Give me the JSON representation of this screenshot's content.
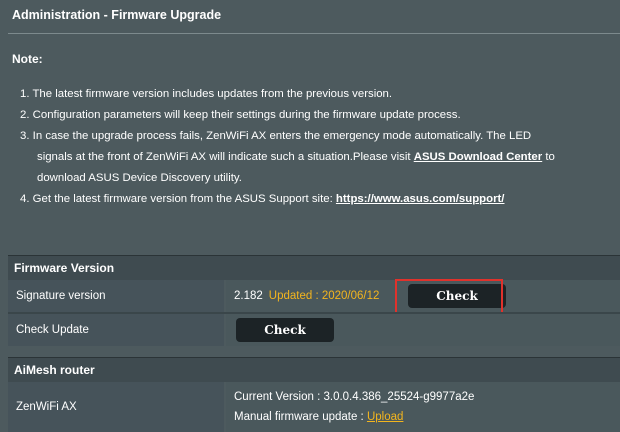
{
  "header": {
    "title": "Administration - Firmware Upgrade"
  },
  "note": {
    "label": "Note:",
    "items": [
      "1. The latest firmware version includes updates from the previous version.",
      "2. Configuration parameters will keep their settings during the firmware update process.",
      "3. In case the upgrade process fails, ZenWiFi AX enters the emergency mode automatically. The LED",
      "signals at the front of ZenWiFi AX will indicate such a situation.Please visit",
      "ASUS Download Center",
      "to",
      "download ASUS Device Discovery utility.",
      "4. Get the latest firmware version from the ASUS Support site:",
      "https://www.asus.com/support/"
    ]
  },
  "firmware": {
    "header": "Firmware Version",
    "signature_label": "Signature version",
    "signature_value": "2.182",
    "signature_updated": "Updated : 2020/06/12",
    "signature_button": "Check",
    "check_update_label": "Check Update",
    "check_update_button": "Check"
  },
  "aimesh": {
    "header": "AiMesh router",
    "device_label": "ZenWiFi AX",
    "current_version": "Current Version : 3.0.0.4.386_25524-g9977a2e",
    "manual_update_label": "Manual firmware update :",
    "upload_link": "Upload"
  },
  "colors": {
    "background": "#4d5a5e",
    "accent_yellow": "#f3b51e",
    "highlight_red": "#e0322c",
    "button_bg": "#1c2326"
  }
}
